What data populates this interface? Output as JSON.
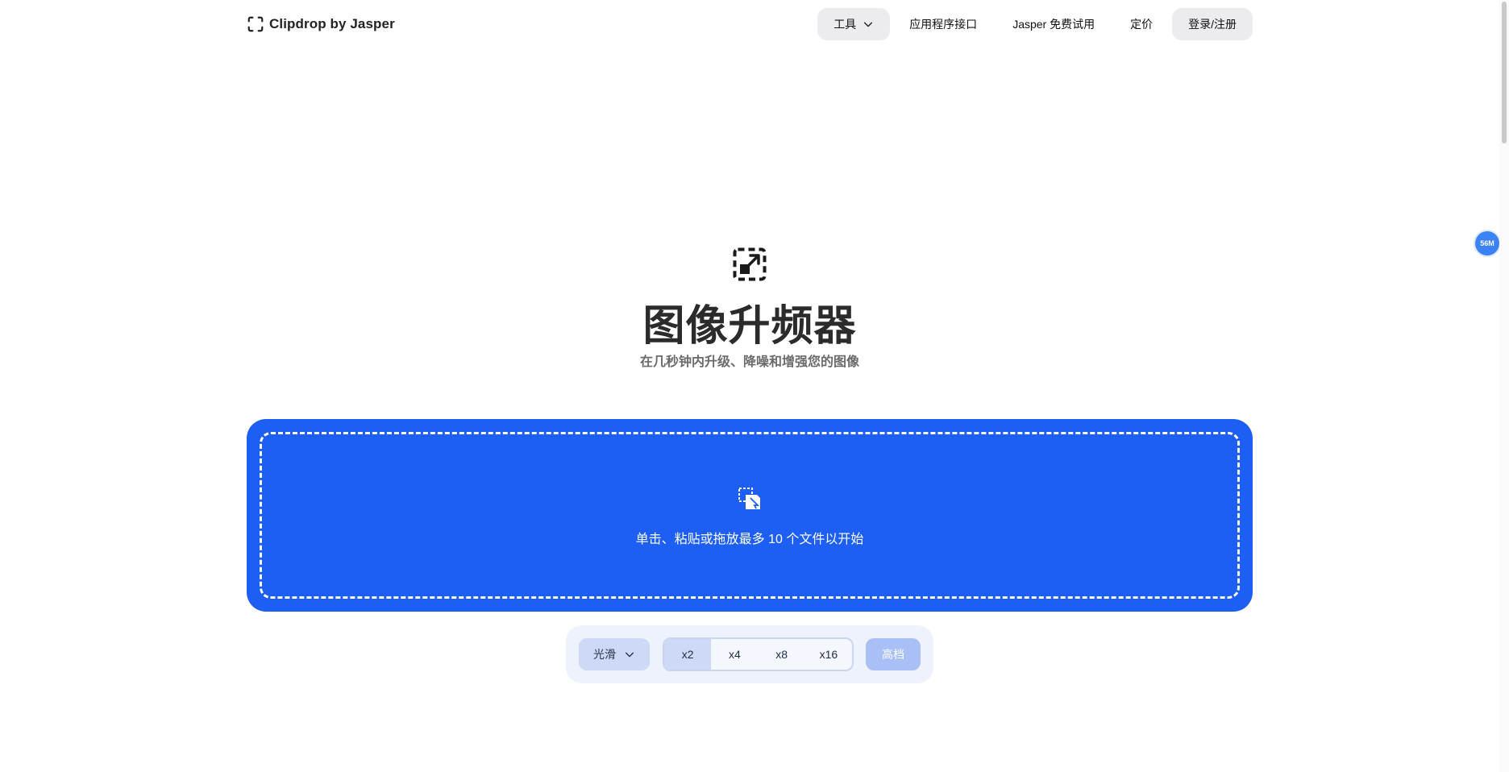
{
  "header": {
    "logo_text": "Clipdrop by Jasper",
    "nav": {
      "tools": "工具",
      "api": "应用程序接口",
      "jasper_trial": "Jasper 免费试用",
      "pricing": "定价",
      "login": "登录/注册"
    }
  },
  "hero": {
    "title": "图像升频器",
    "subtitle": "在几秒钟内升级、降噪和增强您的图像"
  },
  "dropzone": {
    "text": "单击、粘贴或拖放最多 10 个文件以开始"
  },
  "controls": {
    "mode": "光滑",
    "scales": [
      "x2",
      "x4",
      "x8",
      "x16"
    ],
    "selected_scale": "x2",
    "upscale_button": "高档"
  },
  "badge": "56M",
  "colors": {
    "accent": "#1d5ff5",
    "controls_bg": "#eef2fc",
    "selected": "#cdd9f5",
    "disabled_button": "#a9c0f6"
  },
  "icons": {
    "logo": "clipdrop-logo-icon",
    "hero": "upscale-expand-icon",
    "drop": "upload-file-icon",
    "tools_chevron": "chevron-down-icon"
  }
}
